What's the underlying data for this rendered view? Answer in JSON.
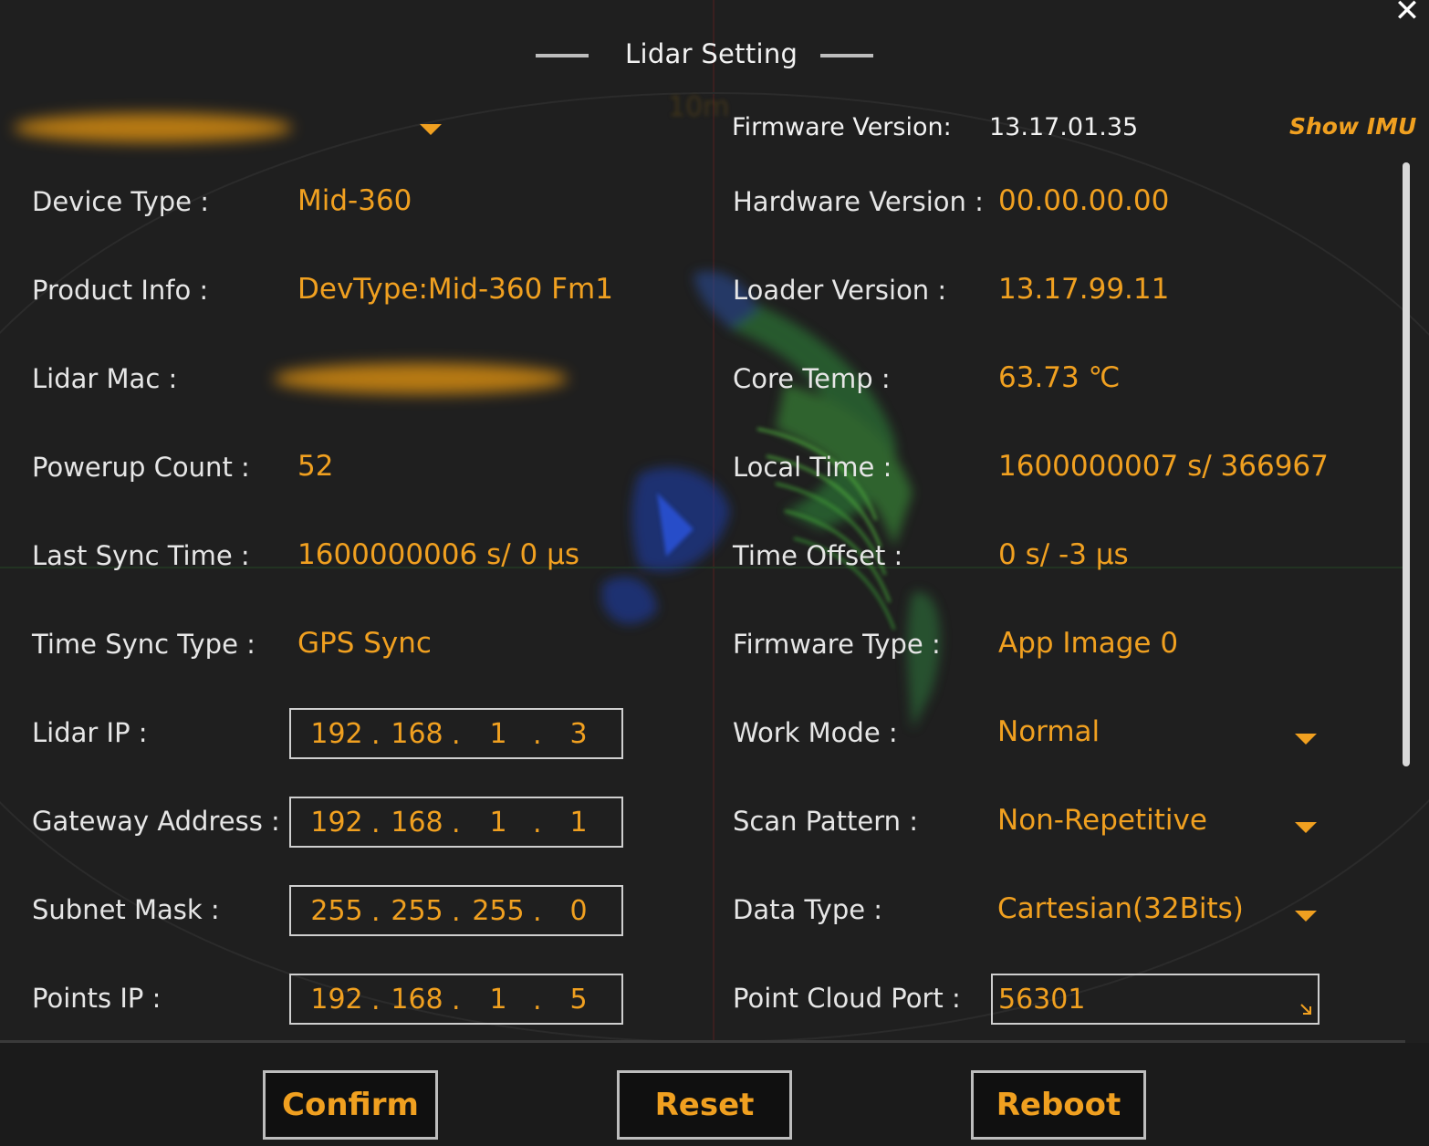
{
  "title": "Lidar Setting",
  "close_glyph": "✕",
  "background_scale_label": "10m",
  "firmware": {
    "label": "Firmware Version:",
    "value": "13.17.01.35"
  },
  "show_imu_label": "Show IMU",
  "left": {
    "device_type": {
      "label": "Device Type :",
      "value": "Mid-360"
    },
    "product_info": {
      "label": "Product Info :",
      "value": "DevType:Mid-360 Fm1"
    },
    "lidar_mac": {
      "label": "Lidar Mac :"
    },
    "powerup_count": {
      "label": "Powerup Count :",
      "value": "52"
    },
    "last_sync_time": {
      "label": "Last Sync Time :",
      "value": "1600000006 s/ 0 μs"
    },
    "time_sync_type": {
      "label": "Time Sync Type :",
      "value": "GPS Sync"
    },
    "lidar_ip": {
      "label": "Lidar IP :",
      "octets": [
        "192",
        "168",
        "1",
        "3"
      ]
    },
    "gateway": {
      "label": "Gateway Address :",
      "octets": [
        "192",
        "168",
        "1",
        "1"
      ]
    },
    "subnet": {
      "label": "Subnet Mask :",
      "octets": [
        "255",
        "255",
        "255",
        "0"
      ]
    },
    "points_ip": {
      "label": "Points IP :",
      "octets": [
        "192",
        "168",
        "1",
        "5"
      ]
    }
  },
  "right": {
    "hardware_version": {
      "label": "Hardware Version :",
      "value": "00.00.00.00"
    },
    "loader_version": {
      "label": "Loader Version :",
      "value": "13.17.99.11"
    },
    "core_temp": {
      "label": "Core Temp :",
      "value": "63.73 ℃"
    },
    "local_time": {
      "label": "Local Time :",
      "value": "1600000007 s/ 366967"
    },
    "time_offset": {
      "label": "Time Offset :",
      "value": "0 s/ -3 μs"
    },
    "firmware_type": {
      "label": "Firmware Type :",
      "value": "App Image 0"
    },
    "work_mode": {
      "label": "Work Mode :",
      "value": "Normal"
    },
    "scan_pattern": {
      "label": "Scan Pattern :",
      "value": "Non-Repetitive"
    },
    "data_type": {
      "label": "Data Type :",
      "value": "Cartesian(32Bits)"
    },
    "point_cloud_port": {
      "label": "Point Cloud Port :",
      "value": "56301"
    }
  },
  "buttons": {
    "confirm": "Confirm",
    "reset": "Reset",
    "reboot": "Reboot"
  },
  "colors": {
    "accent": "#f0a020",
    "background": "#1f1f1f",
    "label": "#e6e6e6"
  }
}
